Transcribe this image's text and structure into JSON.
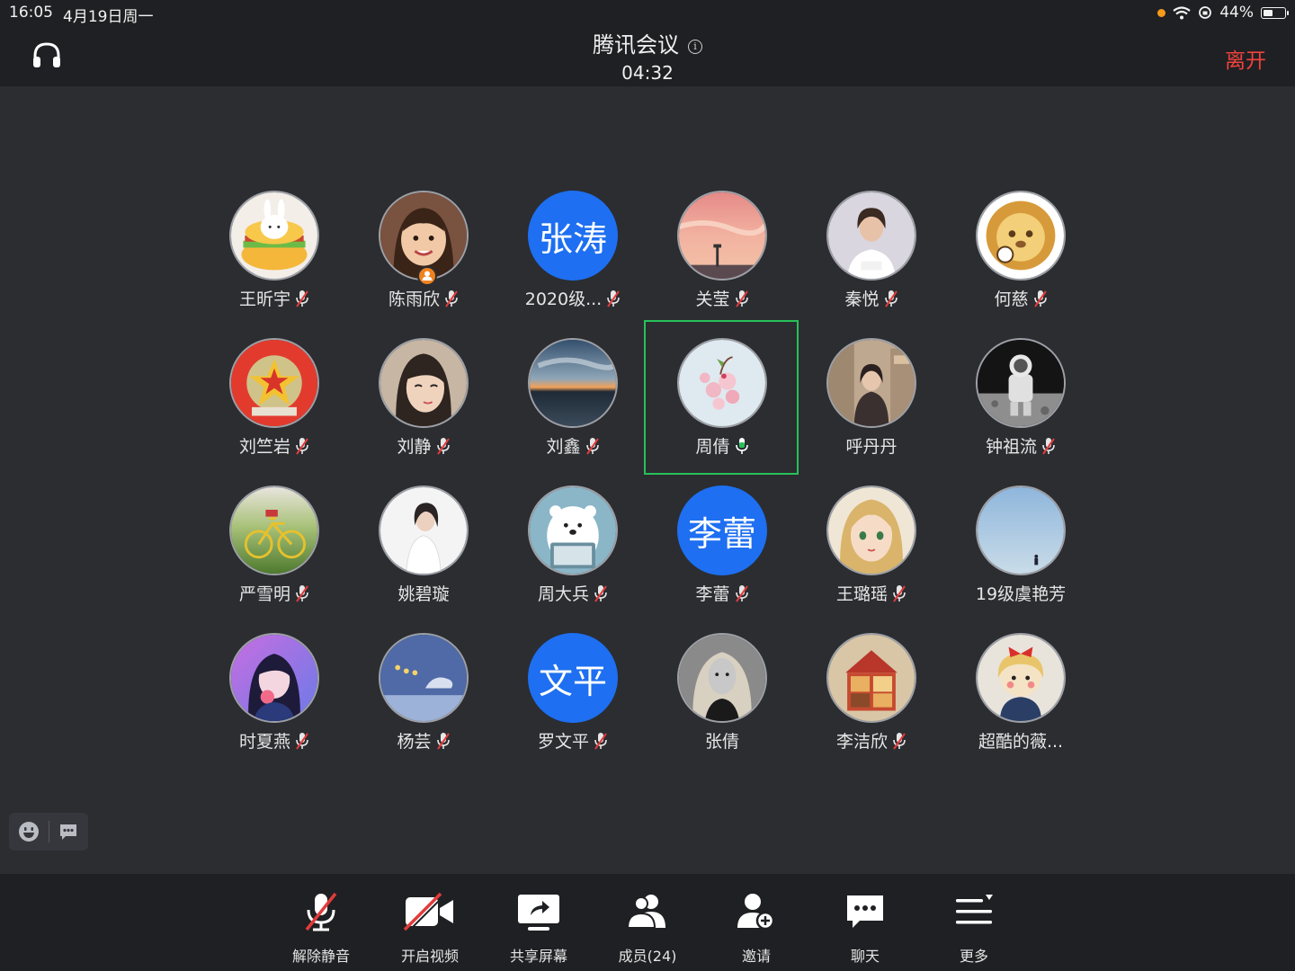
{
  "status": {
    "time": "16:05",
    "date": "4月19日周一",
    "battery": "44%",
    "icons": [
      "recording-dot",
      "wifi-icon",
      "orientation-lock-icon",
      "battery-icon"
    ]
  },
  "header": {
    "title": "腾讯会议",
    "timer": "04:32",
    "leave": "离开",
    "leave_color": "#f0433d"
  },
  "participants": [
    {
      "name": "王昕宇",
      "mic": "muted",
      "avatar": "bunny-burger",
      "active": false
    },
    {
      "name": "陈雨欣",
      "mic": "muted",
      "avatar": "girl-photo",
      "host_badge": true,
      "active": false
    },
    {
      "name": "2020级...",
      "mic": "muted",
      "avatar": "text",
      "avatar_text": "张涛",
      "active": false
    },
    {
      "name": "关莹",
      "mic": "muted",
      "avatar": "pink-sky",
      "active": false
    },
    {
      "name": "秦悦",
      "mic": "muted",
      "avatar": "woman-photo",
      "active": false
    },
    {
      "name": "何慈",
      "mic": "muted",
      "avatar": "lion-cartoon",
      "active": false
    },
    {
      "name": "刘竺岩",
      "mic": "muted",
      "avatar": "red-emblem",
      "active": false
    },
    {
      "name": "刘静",
      "mic": "muted",
      "avatar": "anime-girl",
      "active": false
    },
    {
      "name": "刘鑫",
      "mic": "muted",
      "avatar": "sunset-lake",
      "active": false
    },
    {
      "name": "周倩",
      "mic": "speaking",
      "avatar": "cherry-blossom",
      "active": true
    },
    {
      "name": "呼丹丹",
      "mic": "none",
      "avatar": "girl-street",
      "active": false
    },
    {
      "name": "钟祖流",
      "mic": "muted",
      "avatar": "astronaut",
      "active": false
    },
    {
      "name": "严雪明",
      "mic": "muted",
      "avatar": "yellow-bike",
      "active": false
    },
    {
      "name": "姚碧璇",
      "mic": "none",
      "avatar": "white-dress",
      "active": false
    },
    {
      "name": "周大兵",
      "mic": "muted",
      "avatar": "polar-bear",
      "active": false
    },
    {
      "name": "李蕾",
      "mic": "muted",
      "avatar": "text",
      "avatar_text": "李蕾",
      "active": false
    },
    {
      "name": "王璐瑶",
      "mic": "muted",
      "avatar": "anime-blonde",
      "active": false
    },
    {
      "name": "19级虞艳芳",
      "mic": "none",
      "avatar": "blue-sky",
      "active": false
    },
    {
      "name": "时夏燕",
      "mic": "muted",
      "avatar": "purple-anime",
      "active": false
    },
    {
      "name": "杨芸",
      "mic": "muted",
      "avatar": "whale-moon",
      "active": false
    },
    {
      "name": "罗文平",
      "mic": "muted",
      "avatar": "text",
      "avatar_text": "文平",
      "active": false
    },
    {
      "name": "张倩",
      "mic": "none",
      "avatar": "bw-woman",
      "active": false
    },
    {
      "name": "李洁欣",
      "mic": "muted",
      "avatar": "dollhouse",
      "active": false
    },
    {
      "name": "超酷的薇...",
      "mic": "none",
      "avatar": "red-bow-girl",
      "active": false
    }
  ],
  "side_tools": [
    {
      "icon": "emoji-icon"
    },
    {
      "icon": "chat-bubble-icon"
    }
  ],
  "toolbar": [
    {
      "label": "解除静音",
      "icon": "mic-muted-icon"
    },
    {
      "label": "开启视频",
      "icon": "video-off-icon"
    },
    {
      "label": "共享屏幕",
      "icon": "share-screen-icon"
    },
    {
      "label": "成员(24)",
      "icon": "members-icon"
    },
    {
      "label": "邀请",
      "icon": "invite-icon"
    },
    {
      "label": "聊天",
      "icon": "chat-icon"
    },
    {
      "label": "更多",
      "icon": "more-icon"
    }
  ],
  "colors": {
    "background": "#2b2d31",
    "bar": "#1f2023",
    "speaking_frame": "#27c15a",
    "text_avatar": "#1e6ff1",
    "muted_slash": "#e23b3b"
  }
}
